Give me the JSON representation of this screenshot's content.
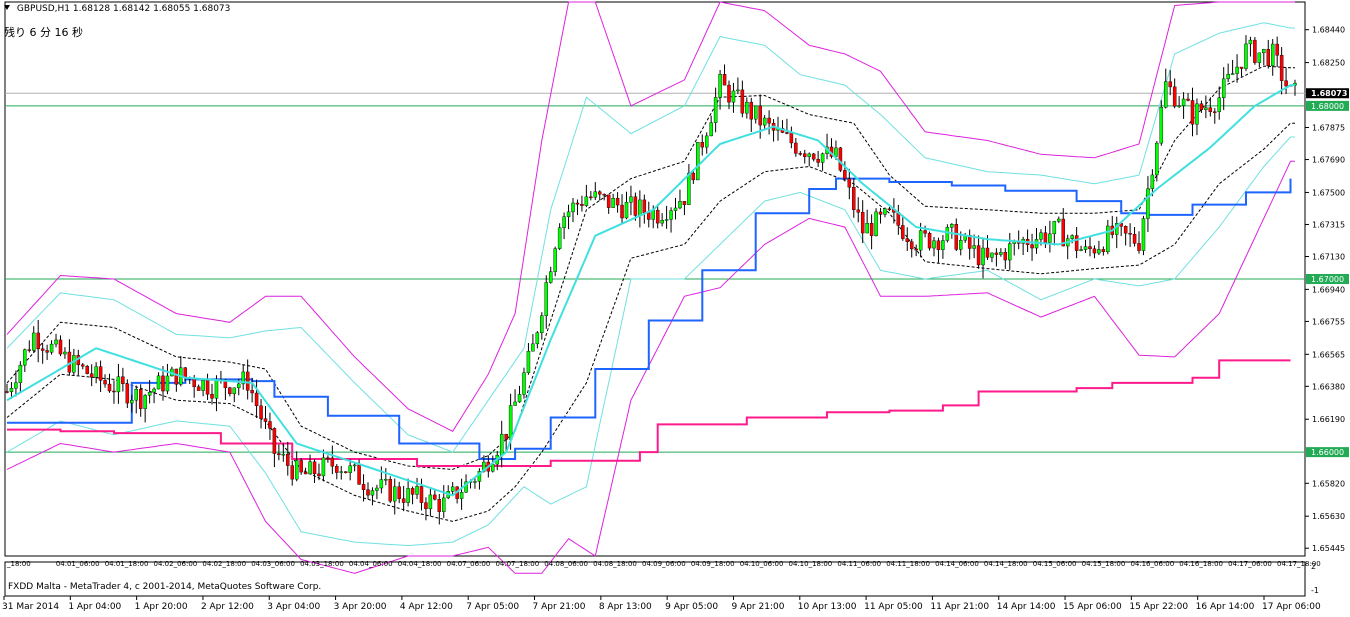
{
  "header": {
    "symbol": "GBPUSD,H1",
    "ohlc": "1.68128 1.68142 1.68055 1.68073",
    "remaining": "残り 6 分 16 秒"
  },
  "footer": {
    "broker": "FXDD Malta - MetaTrader 4, c 2001-2014, MetaQuotes Software Corp."
  },
  "indicator_panel": {
    "labels": [
      "2",
      "-1"
    ]
  },
  "chart_data": {
    "type": "candlestick",
    "symbol": "GBPUSD",
    "timeframe": "H1",
    "ylim": [
      1.654,
      1.686
    ],
    "price_ticks": [
      "1.68440",
      "1.68250",
      "1.68073",
      "1.68000",
      "1.67875",
      "1.67690",
      "1.67500",
      "1.67315",
      "1.67130",
      "1.67000",
      "1.66940",
      "1.66755",
      "1.66565",
      "1.66380",
      "1.66190",
      "1.66000",
      "1.65820",
      "1.65630",
      "1.65445"
    ],
    "current_price": 1.68073,
    "horizontal_levels": [
      1.68,
      1.67,
      1.66
    ],
    "upper_time_labels": [
      "_18:00",
      "04.01_06:00",
      "04.01_18:00",
      "04.02_06:00",
      "04.02_18:00",
      "04.03_06:00",
      "04.03_18:00",
      "04.04_06:00",
      "04.04_18:00",
      "04.07_06:00",
      "04.07_18:00",
      "04.08_06:00",
      "04.08_18:00",
      "04.09_06:00",
      "04.09_18:00",
      "04.10_06:00",
      "04.10_18:00",
      "04.11_06:00",
      "04.11_18:00",
      "04.14_06:00",
      "04.14_18:00",
      "04.15_06:00",
      "04.15_18:00",
      "04.16_06:00",
      "04.16_18:00",
      "04.17_06:00",
      "04.17_18:00"
    ],
    "lower_time_labels": [
      "31 Mar 2014",
      "1 Apr 04:00",
      "1 Apr 20:00",
      "2 Apr 12:00",
      "3 Apr 04:00",
      "3 Apr 20:00",
      "4 Apr 12:00",
      "7 Apr 05:00",
      "7 Apr 21:00",
      "8 Apr 13:00",
      "9 Apr 05:00",
      "9 Apr 21:00",
      "10 Apr 13:00",
      "11 Apr 05:00",
      "11 Apr 21:00",
      "14 Apr 14:00",
      "15 Apr 06:00",
      "15 Apr 22:00",
      "16 Apr 14:00",
      "17 Apr 06:00"
    ],
    "close_path": [
      [
        0,
        1.6635
      ],
      [
        6,
        1.6668
      ],
      [
        14,
        1.6652
      ],
      [
        22,
        1.664
      ],
      [
        30,
        1.6632
      ],
      [
        38,
        1.6645
      ],
      [
        46,
        1.6638
      ],
      [
        54,
        1.6641
      ],
      [
        60,
        1.66
      ],
      [
        66,
        1.6586
      ],
      [
        74,
        1.6594
      ],
      [
        82,
        1.658
      ],
      [
        90,
        1.6575
      ],
      [
        98,
        1.657
      ],
      [
        106,
        1.6588
      ],
      [
        112,
        1.6612
      ],
      [
        118,
        1.666
      ],
      [
        124,
        1.6735
      ],
      [
        130,
        1.6748
      ],
      [
        138,
        1.6742
      ],
      [
        146,
        1.6738
      ],
      [
        152,
        1.6748
      ],
      [
        160,
        1.6812
      ],
      [
        166,
        1.6798
      ],
      [
        172,
        1.6785
      ],
      [
        178,
        1.6776
      ],
      [
        186,
        1.677
      ],
      [
        192,
        1.6728
      ],
      [
        198,
        1.6736
      ],
      [
        204,
        1.6722
      ],
      [
        212,
        1.6725
      ],
      [
        220,
        1.671
      ],
      [
        228,
        1.6722
      ],
      [
        236,
        1.6728
      ],
      [
        242,
        1.6715
      ],
      [
        248,
        1.6726
      ],
      [
        254,
        1.6722
      ],
      [
        260,
        1.6812
      ],
      [
        266,
        1.6795
      ],
      [
        272,
        1.6805
      ],
      [
        278,
        1.6832
      ],
      [
        284,
        1.6829
      ],
      [
        288,
        1.6807
      ]
    ],
    "ma_fast": [
      [
        0,
        1.663
      ],
      [
        20,
        1.666
      ],
      [
        40,
        1.6643
      ],
      [
        55,
        1.664
      ],
      [
        65,
        1.6605
      ],
      [
        85,
        1.6588
      ],
      [
        100,
        1.6575
      ],
      [
        112,
        1.66
      ],
      [
        122,
        1.6665
      ],
      [
        132,
        1.6725
      ],
      [
        145,
        1.674
      ],
      [
        160,
        1.6778
      ],
      [
        172,
        1.6788
      ],
      [
        182,
        1.678
      ],
      [
        192,
        1.6755
      ],
      [
        204,
        1.673
      ],
      [
        220,
        1.6723
      ],
      [
        236,
        1.672
      ],
      [
        248,
        1.6728
      ],
      [
        258,
        1.6752
      ],
      [
        270,
        1.6776
      ],
      [
        280,
        1.68
      ],
      [
        288,
        1.6812
      ]
    ],
    "ma_mid": [
      [
        0,
        1.6612
      ],
      [
        30,
        1.6633
      ],
      [
        55,
        1.664
      ],
      [
        75,
        1.6618
      ],
      [
        95,
        1.6604
      ],
      [
        112,
        1.66
      ],
      [
        120,
        1.661
      ],
      [
        132,
        1.664
      ],
      [
        144,
        1.6682
      ],
      [
        156,
        1.6715
      ],
      [
        168,
        1.674
      ],
      [
        176,
        1.6762
      ],
      [
        182,
        1.6767
      ],
      [
        194,
        1.6762
      ],
      [
        206,
        1.6756
      ],
      [
        220,
        1.6748
      ],
      [
        234,
        1.6745
      ],
      [
        246,
        1.6737
      ],
      [
        254,
        1.6738
      ],
      [
        266,
        1.6748
      ],
      [
        280,
        1.6758
      ],
      [
        288,
        1.6763
      ]
    ],
    "ma_slow": [
      [
        0,
        1.6617
      ],
      [
        30,
        1.6612
      ],
      [
        55,
        1.6606
      ],
      [
        70,
        1.6598
      ],
      [
        90,
        1.6595
      ],
      [
        112,
        1.6597
      ],
      [
        132,
        1.6606
      ],
      [
        150,
        1.6622
      ],
      [
        172,
        1.6629
      ],
      [
        194,
        1.6632
      ],
      [
        206,
        1.6637
      ],
      [
        230,
        1.6642
      ],
      [
        254,
        1.6647
      ],
      [
        270,
        1.6652
      ],
      [
        288,
        1.6659
      ]
    ],
    "band_inner": [
      [
        0,
        1.666,
        1.66
      ],
      [
        12,
        1.6692,
        1.6618
      ],
      [
        24,
        1.6688,
        1.661
      ],
      [
        38,
        1.6668,
        1.6618
      ],
      [
        50,
        1.6666,
        1.6615
      ],
      [
        58,
        1.667,
        1.6588
      ],
      [
        66,
        1.6672,
        1.6554
      ],
      [
        78,
        1.664,
        1.6548
      ],
      [
        90,
        1.661,
        1.6546
      ],
      [
        100,
        1.66,
        1.6548
      ],
      [
        108,
        1.663,
        1.6558
      ],
      [
        116,
        1.666,
        1.658
      ],
      [
        122,
        1.674,
        1.657
      ],
      [
        130,
        1.6805,
        1.658
      ],
      [
        140,
        1.6784,
        1.67
      ],
      [
        152,
        1.68,
        1.67
      ],
      [
        160,
        1.684,
        1.672
      ],
      [
        170,
        1.6835,
        1.6745
      ],
      [
        178,
        1.6818,
        1.675
      ],
      [
        188,
        1.6812,
        1.674
      ],
      [
        196,
        1.6795,
        1.6705
      ],
      [
        206,
        1.677,
        1.67
      ],
      [
        220,
        1.6762,
        1.6705
      ],
      [
        232,
        1.676,
        1.6688
      ],
      [
        244,
        1.6755,
        1.67
      ],
      [
        254,
        1.676,
        1.6696
      ],
      [
        262,
        1.683,
        1.67
      ],
      [
        272,
        1.6842,
        1.673
      ],
      [
        282,
        1.6848,
        1.6765
      ],
      [
        288,
        1.6845,
        1.6782
      ]
    ],
    "band_outer": [
      [
        0,
        1.6668,
        1.659
      ],
      [
        12,
        1.6702,
        1.6605
      ],
      [
        24,
        1.67,
        1.66
      ],
      [
        38,
        1.668,
        1.6605
      ],
      [
        50,
        1.6675,
        1.66
      ],
      [
        58,
        1.669,
        1.656
      ],
      [
        66,
        1.669,
        1.6538
      ],
      [
        78,
        1.6655,
        1.653
      ],
      [
        90,
        1.6625,
        1.654
      ],
      [
        100,
        1.6612,
        1.654
      ],
      [
        108,
        1.6645,
        1.6545
      ],
      [
        114,
        1.668,
        1.653
      ],
      [
        120,
        1.678,
        1.653
      ],
      [
        126,
        1.686,
        1.655
      ],
      [
        132,
        1.686,
        1.654
      ],
      [
        140,
        1.68,
        1.663
      ],
      [
        152,
        1.6815,
        1.669
      ],
      [
        160,
        1.686,
        1.6695
      ],
      [
        170,
        1.6855,
        1.672
      ],
      [
        180,
        1.6835,
        1.6735
      ],
      [
        188,
        1.683,
        1.673
      ],
      [
        196,
        1.682,
        1.669
      ],
      [
        206,
        1.6785,
        1.669
      ],
      [
        220,
        1.678,
        1.6692
      ],
      [
        232,
        1.6772,
        1.6678
      ],
      [
        244,
        1.677,
        1.669
      ],
      [
        254,
        1.6778,
        1.6656
      ],
      [
        262,
        1.6858,
        1.6655
      ],
      [
        272,
        1.686,
        1.668
      ],
      [
        282,
        1.686,
        1.6735
      ],
      [
        288,
        1.686,
        1.6768
      ]
    ],
    "envelope_upper": [
      [
        0,
        1.664
      ],
      [
        12,
        1.6675
      ],
      [
        24,
        1.6672
      ],
      [
        38,
        1.6655
      ],
      [
        50,
        1.6652
      ],
      [
        58,
        1.6648
      ],
      [
        66,
        1.6615
      ],
      [
        78,
        1.66
      ],
      [
        90,
        1.6592
      ],
      [
        100,
        1.659
      ],
      [
        108,
        1.6598
      ],
      [
        114,
        1.6612
      ],
      [
        120,
        1.666
      ],
      [
        130,
        1.674
      ],
      [
        140,
        1.6758
      ],
      [
        152,
        1.6768
      ],
      [
        160,
        1.6805
      ],
      [
        170,
        1.6806
      ],
      [
        180,
        1.6795
      ],
      [
        190,
        1.679
      ],
      [
        198,
        1.676
      ],
      [
        206,
        1.6742
      ],
      [
        220,
        1.674
      ],
      [
        232,
        1.6738
      ],
      [
        244,
        1.6738
      ],
      [
        254,
        1.674
      ],
      [
        262,
        1.678
      ],
      [
        272,
        1.681
      ],
      [
        282,
        1.6823
      ],
      [
        288,
        1.6822
      ]
    ],
    "envelope_lower": [
      [
        0,
        1.662
      ],
      [
        12,
        1.6645
      ],
      [
        24,
        1.6642
      ],
      [
        38,
        1.663
      ],
      [
        50,
        1.6628
      ],
      [
        58,
        1.6618
      ],
      [
        66,
        1.659
      ],
      [
        78,
        1.6575
      ],
      [
        90,
        1.6566
      ],
      [
        100,
        1.656
      ],
      [
        108,
        1.6566
      ],
      [
        114,
        1.658
      ],
      [
        120,
        1.66
      ],
      [
        130,
        1.664
      ],
      [
        140,
        1.6712
      ],
      [
        152,
        1.672
      ],
      [
        160,
        1.6745
      ],
      [
        170,
        1.6762
      ],
      [
        180,
        1.6765
      ],
      [
        190,
        1.6755
      ],
      [
        198,
        1.6738
      ],
      [
        206,
        1.671
      ],
      [
        220,
        1.6706
      ],
      [
        232,
        1.6703
      ],
      [
        244,
        1.6706
      ],
      [
        254,
        1.6708
      ],
      [
        262,
        1.672
      ],
      [
        272,
        1.6755
      ],
      [
        282,
        1.6775
      ],
      [
        288,
        1.679
      ]
    ],
    "blue_trail": [
      [
        0,
        1.6617
      ],
      [
        28,
        1.664
      ],
      [
        40,
        1.6642
      ],
      [
        55,
        1.6641
      ],
      [
        60,
        1.6632
      ],
      [
        72,
        1.6621
      ],
      [
        88,
        1.6605
      ],
      [
        106,
        1.6596
      ],
      [
        114,
        1.6602
      ],
      [
        122,
        1.662
      ],
      [
        132,
        1.6648
      ],
      [
        144,
        1.6676
      ],
      [
        156,
        1.6705
      ],
      [
        168,
        1.6738
      ],
      [
        180,
        1.6752
      ],
      [
        186,
        1.6758
      ],
      [
        198,
        1.6756
      ],
      [
        212,
        1.6754
      ],
      [
        224,
        1.6751
      ],
      [
        240,
        1.6745
      ],
      [
        250,
        1.6738
      ],
      [
        256,
        1.6737
      ],
      [
        266,
        1.6743
      ],
      [
        278,
        1.675
      ],
      [
        288,
        1.6758
      ]
    ],
    "magenta_trail": [
      [
        0,
        1.6613
      ],
      [
        12,
        1.6612
      ],
      [
        24,
        1.6611
      ],
      [
        48,
        1.6605
      ],
      [
        62,
        1.6605
      ],
      [
        64,
        1.6596
      ],
      [
        84,
        1.6596
      ],
      [
        92,
        1.6592
      ],
      [
        112,
        1.6592
      ],
      [
        122,
        1.6595
      ],
      [
        142,
        1.66
      ],
      [
        146,
        1.6616
      ],
      [
        166,
        1.662
      ],
      [
        184,
        1.6623
      ],
      [
        198,
        1.6624
      ],
      [
        210,
        1.6627
      ],
      [
        218,
        1.6635
      ],
      [
        240,
        1.6637
      ],
      [
        248,
        1.664
      ],
      [
        266,
        1.6643
      ],
      [
        272,
        1.6653
      ],
      [
        288,
        1.6653
      ]
    ],
    "legend": "none",
    "grid": false
  },
  "colors": {
    "background": "#ffffff",
    "bull_candle": "#00ff00",
    "bear_candle": "#ff0000",
    "candle_wick": "#000000",
    "ma_fast": "#40e0e0",
    "ma_slow": "#1e64ff",
    "band_inner": "#70e0e0",
    "band_outer": "#dd22dd",
    "envelope": "#000000",
    "trail_magenta": "#ff1a8c",
    "level_line": "#22aa55",
    "current_price_box": "#000000",
    "current_price_text": "#ffffff",
    "level_box": "#22aa55"
  }
}
